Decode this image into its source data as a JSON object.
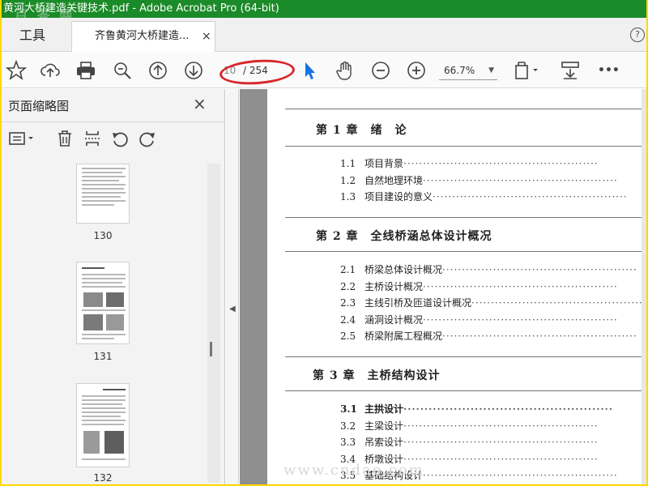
{
  "window": {
    "title": "黄河大桥建造关键技术.pdf - Adobe Acrobat Pro (64-bit)"
  },
  "tabs": {
    "tools_label": "工具",
    "doc_label": "齐鲁黄河大桥建造...",
    "close_glyph": "×",
    "help_glyph": "?"
  },
  "toolbar": {
    "page_current": "10",
    "page_total": "/ 254",
    "zoom": "66.7%",
    "more_glyph": "•••"
  },
  "panel": {
    "title": "页面缩略图",
    "close_glyph": "×",
    "thumbnails": [
      {
        "label": "130"
      },
      {
        "label": "131"
      },
      {
        "label": "132"
      }
    ]
  },
  "document": {
    "chapters": [
      {
        "heading": "第 1 章　绪　论",
        "sections": [
          {
            "num": "1.1",
            "title": "项目背景"
          },
          {
            "num": "1.2",
            "title": "自然地理环境"
          },
          {
            "num": "1.3",
            "title": "项目建设的意义"
          }
        ]
      },
      {
        "heading": "第 2 章　全线桥涵总体设计概况",
        "sections": [
          {
            "num": "2.1",
            "title": "桥梁总体设计概况"
          },
          {
            "num": "2.2",
            "title": "主桥设计概况"
          },
          {
            "num": "2.3",
            "title": "主线引桥及匝道设计概况"
          },
          {
            "num": "2.4",
            "title": "涵洞设计概况"
          },
          {
            "num": "2.5",
            "title": "桥梁附属工程概况"
          }
        ]
      },
      {
        "heading": "第 3 章　主桥结构设计",
        "sections": [
          {
            "num": "3.1",
            "title": "主拱设计"
          },
          {
            "num": "3.2",
            "title": "主梁设计"
          },
          {
            "num": "3.3",
            "title": "吊索设计"
          },
          {
            "num": "3.4",
            "title": "桥墩设计"
          },
          {
            "num": "3.5",
            "title": "基础结构设计"
          }
        ]
      }
    ],
    "dots": "··················································"
  },
  "watermarks": {
    "top": "百 答 网",
    "bottom": "www.cndao.com"
  },
  "colors": {
    "titlebar": "#1b8a28",
    "frame": "#ffd800",
    "highlight_oval": "#d9262c",
    "cursor_blue": "#1473e6"
  },
  "icons": [
    "star-icon",
    "cloud-upload-icon",
    "print-icon",
    "zoom-search-icon",
    "arrow-up-icon",
    "arrow-down-icon",
    "select-cursor-icon",
    "hand-icon",
    "zoom-out-icon",
    "zoom-in-icon",
    "page-fit-icon",
    "scroll-mode-icon",
    "more-icon",
    "options-icon",
    "trash-icon",
    "insert-pages-icon",
    "rotate-left-icon",
    "rotate-right-icon"
  ]
}
